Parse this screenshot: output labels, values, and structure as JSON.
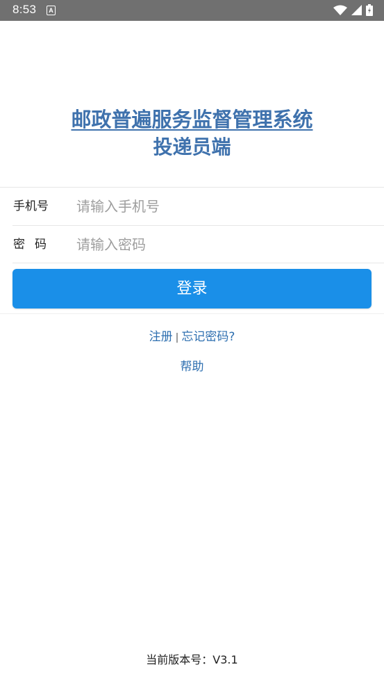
{
  "status_bar": {
    "time": "8:53",
    "notification_icon_letter": "A",
    "icons": [
      "wifi-icon",
      "signal-icon",
      "battery-icon"
    ]
  },
  "header": {
    "title": "邮政普遍服务监督管理系统",
    "subtitle": "投递员端",
    "title_color": "#3f72ad"
  },
  "form": {
    "phone": {
      "label": "手机号",
      "placeholder": "请输入手机号",
      "value": ""
    },
    "password": {
      "label": "密码",
      "placeholder": "请输入密码",
      "value": ""
    },
    "login_label": "登录",
    "login_color": "#1a8fe8"
  },
  "links": {
    "register": "注册",
    "separator": "|",
    "forgot_password": "忘记密码?",
    "help": "帮助"
  },
  "footer": {
    "version": "当前版本号：V3.1"
  }
}
